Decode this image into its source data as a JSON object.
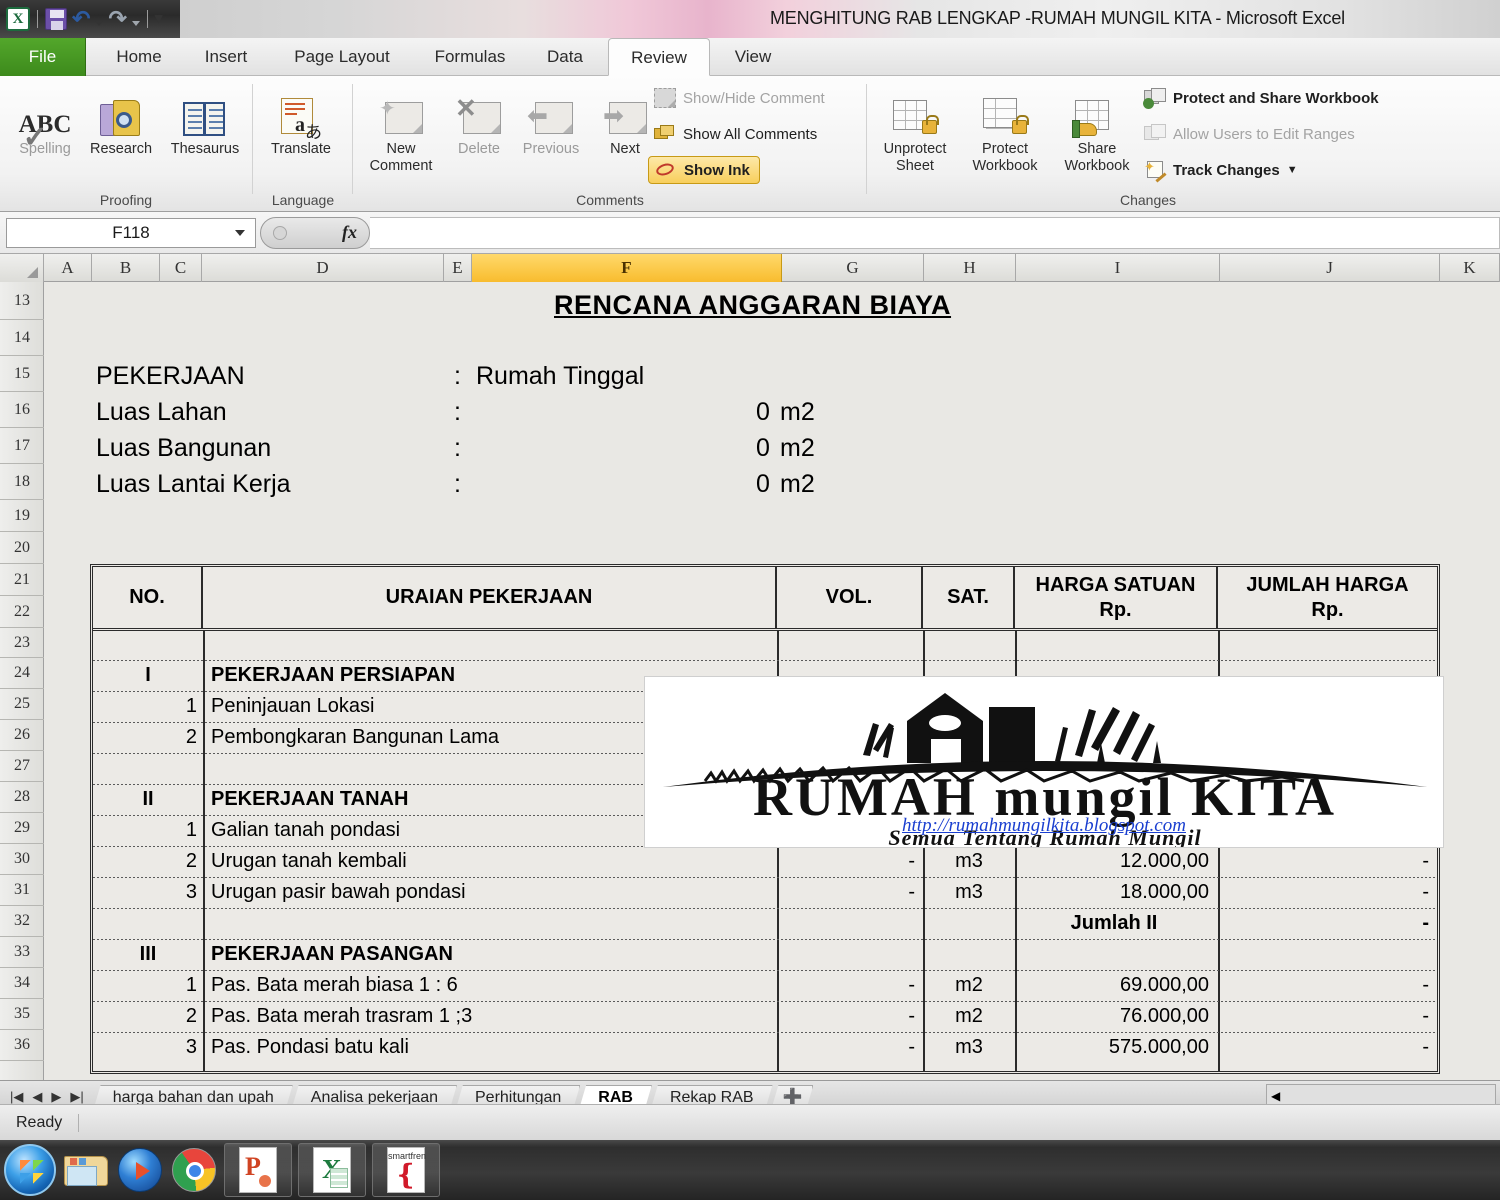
{
  "window": {
    "title": "MENGHITUNG RAB LENGKAP -RUMAH MUNGIL KITA  -  Microsoft Excel"
  },
  "quick_access": {
    "app_icon": "excel-logo-icon",
    "items": [
      {
        "name": "save-icon",
        "label": "Save"
      },
      {
        "name": "undo-icon",
        "label": "Undo"
      },
      {
        "name": "redo-icon",
        "label": "Redo"
      },
      {
        "name": "customize-qat-icon",
        "label": "Customize Quick Access Toolbar"
      }
    ]
  },
  "ribbon": {
    "tabs": [
      {
        "label": "File"
      },
      {
        "label": "Home"
      },
      {
        "label": "Insert"
      },
      {
        "label": "Page Layout"
      },
      {
        "label": "Formulas"
      },
      {
        "label": "Data"
      },
      {
        "label": "Review"
      },
      {
        "label": "View"
      }
    ],
    "active_tab": "Review",
    "groups": {
      "proofing": {
        "label": "Proofing",
        "buttons": [
          {
            "label": "Spelling",
            "icon": "abc-check-icon"
          },
          {
            "label": "Research",
            "icon": "book-magnifier-icon"
          },
          {
            "label": "Thesaurus",
            "icon": "open-book-icon"
          }
        ]
      },
      "language": {
        "label": "Language",
        "buttons": [
          {
            "label": "Translate",
            "icon": "translate-icon"
          }
        ]
      },
      "comments": {
        "label": "Comments",
        "buttons": [
          {
            "label_line1": "New",
            "label_line2": "Comment",
            "icon": "new-comment-icon"
          },
          {
            "label_line1": "Delete",
            "label_line2": "",
            "icon": "delete-comment-icon"
          },
          {
            "label_line1": "Previous",
            "label_line2": "",
            "icon": "previous-comment-icon"
          },
          {
            "label_line1": "Next",
            "label_line2": "",
            "icon": "next-comment-icon"
          }
        ],
        "small_items": [
          {
            "label": "Show/Hide Comment",
            "icon": "show-hide-comment-icon",
            "disabled": true
          },
          {
            "label": "Show All Comments",
            "icon": "show-all-comments-icon",
            "disabled": false
          },
          {
            "label": "Show Ink",
            "icon": "show-ink-icon",
            "disabled": false,
            "active": true
          }
        ]
      },
      "changes": {
        "label": "Changes",
        "buttons": [
          {
            "label_line1": "Unprotect",
            "label_line2": "Sheet",
            "icon": "unprotect-sheet-icon"
          },
          {
            "label_line1": "Protect",
            "label_line2": "Workbook",
            "icon": "protect-workbook-icon"
          },
          {
            "label_line1": "Share",
            "label_line2": "Workbook",
            "icon": "share-workbook-icon"
          }
        ],
        "small_items": [
          {
            "label": "Protect and Share Workbook",
            "icon": "protect-share-workbook-icon",
            "disabled": false
          },
          {
            "label": "Allow Users to Edit Ranges",
            "icon": "allow-users-edit-ranges-icon",
            "disabled": true
          },
          {
            "label": "Track Changes",
            "icon": "track-changes-icon",
            "disabled": false,
            "dropdown": true
          }
        ]
      }
    }
  },
  "formula_bar": {
    "name_box_value": "F118",
    "formula_value": "",
    "fx_label": "fx"
  },
  "grid": {
    "columns": [
      "A",
      "B",
      "C",
      "D",
      "E",
      "F",
      "G",
      "H",
      "I",
      "J",
      "K"
    ],
    "selected_column": "F",
    "rows": [
      "13",
      "14",
      "15",
      "16",
      "17",
      "18",
      "19",
      "20",
      "21",
      "22",
      "23",
      "24",
      "25",
      "26",
      "27",
      "28",
      "29",
      "30",
      "31",
      "32",
      "33",
      "34",
      "35",
      "36"
    ]
  },
  "sheet_content": {
    "title": "RENCANA ANGGARAN BIAYA",
    "info_rows": [
      {
        "label": "PEKERJAAN",
        "sep": ":",
        "value": "Rumah Tinggal",
        "unit": ""
      },
      {
        "label": "Luas Lahan",
        "sep": ":",
        "value": "0",
        "unit": "m2"
      },
      {
        "label": "Luas Bangunan",
        "sep": ":",
        "value": "0",
        "unit": "m2"
      },
      {
        "label": "Luas Lantai Kerja",
        "sep": ":",
        "value": "0",
        "unit": "m2"
      }
    ],
    "table_headers": [
      {
        "line1": "NO.",
        "line2": ""
      },
      {
        "line1": "URAIAN PEKERJAAN",
        "line2": ""
      },
      {
        "line1": "VOL.",
        "line2": ""
      },
      {
        "line1": "SAT.",
        "line2": ""
      },
      {
        "line1": "HARGA SATUAN",
        "line2": "Rp."
      },
      {
        "line1": "JUMLAH HARGA",
        "line2": "Rp."
      }
    ],
    "table_rows": [
      {
        "row": "23",
        "no": "",
        "uraian": "",
        "vol": "",
        "sat": "",
        "harga": "",
        "jumlah": "",
        "type": "blank"
      },
      {
        "row": "24",
        "no": "I",
        "uraian": "PEKERJAAN PERSIAPAN",
        "vol": "",
        "sat": "",
        "harga": "",
        "jumlah": "",
        "type": "section"
      },
      {
        "row": "25",
        "no": "1",
        "uraian": "Peninjauan Lokasi",
        "vol": "",
        "sat": "",
        "harga": "",
        "jumlah": "",
        "type": "item"
      },
      {
        "row": "26",
        "no": "2",
        "uraian": "Pembongkaran Bangunan Lama",
        "vol": "",
        "sat": "",
        "harga": "",
        "jumlah": "",
        "type": "item"
      },
      {
        "row": "27",
        "no": "",
        "uraian": "",
        "vol": "",
        "sat": "",
        "harga": "",
        "jumlah": "",
        "type": "blank"
      },
      {
        "row": "28",
        "no": "II",
        "uraian": "PEKERJAAN TANAH",
        "vol": "",
        "sat": "",
        "harga": "",
        "jumlah": "",
        "type": "section"
      },
      {
        "row": "29",
        "no": "1",
        "uraian": "Galian tanah pondasi",
        "vol": "",
        "sat": "",
        "harga": "",
        "jumlah": "",
        "type": "item"
      },
      {
        "row": "30",
        "no": "2",
        "uraian": "Urugan tanah kembali",
        "vol": "-",
        "sat": "m3",
        "harga": "12.000,00",
        "jumlah": "-",
        "type": "item"
      },
      {
        "row": "31",
        "no": "3",
        "uraian": "Urugan pasir bawah pondasi",
        "vol": "-",
        "sat": "m3",
        "harga": "18.000,00",
        "jumlah": "-",
        "type": "item"
      },
      {
        "row": "32",
        "no": "",
        "uraian": "",
        "vol": "",
        "sat": "",
        "harga": "Jumlah II",
        "jumlah": "-",
        "type": "total"
      },
      {
        "row": "33",
        "no": "III",
        "uraian": "PEKERJAAN PASANGAN",
        "vol": "",
        "sat": "",
        "harga": "",
        "jumlah": "",
        "type": "section"
      },
      {
        "row": "34",
        "no": "1",
        "uraian": "Pas. Bata merah biasa 1 : 6",
        "vol": "-",
        "sat": "m2",
        "harga": "69.000,00",
        "jumlah": "-",
        "type": "item"
      },
      {
        "row": "35",
        "no": "2",
        "uraian": "Pas. Bata merah trasram 1 ;3",
        "vol": "-",
        "sat": "m2",
        "harga": "76.000,00",
        "jumlah": "-",
        "type": "item"
      },
      {
        "row": "36",
        "no": "3",
        "uraian": "Pas. Pondasi batu kali",
        "vol": "-",
        "sat": "m3",
        "harga": "575.000,00",
        "jumlah": "-",
        "type": "item"
      }
    ]
  },
  "logo_overlay": {
    "brand_line1": "RUMAH mungil KITA",
    "tagline": "Semua Tentang Rumah Mungil",
    "url": "http://rumahmungilkita.blogspot.com"
  },
  "sheet_tabs": {
    "nav": [
      "|◀",
      "◀",
      "▶",
      "▶|"
    ],
    "tabs": [
      {
        "label": "harga bahan dan upah",
        "active": false
      },
      {
        "label": "Analisa pekerjaan",
        "active": false
      },
      {
        "label": "Perhitungan",
        "active": false
      },
      {
        "label": "RAB",
        "active": true
      },
      {
        "label": "Rekap RAB",
        "active": false
      }
    ],
    "new_sheet_label": "➕"
  },
  "status_bar": {
    "state": "Ready"
  },
  "taskbar": {
    "items": [
      {
        "name": "start-button",
        "label": "Start"
      },
      {
        "name": "windows-explorer-icon",
        "label": "Windows Explorer"
      },
      {
        "name": "media-player-icon",
        "label": "Windows Media Player"
      },
      {
        "name": "chrome-icon",
        "label": "Google Chrome"
      },
      {
        "name": "powerpoint-icon",
        "label": "Microsoft PowerPoint"
      },
      {
        "name": "excel-icon",
        "label": "Microsoft Excel"
      },
      {
        "name": "smartfren-icon",
        "label": "Smartfren"
      }
    ],
    "smartfren_label": "smartfren"
  },
  "colors": {
    "accent_green": "#53a72b",
    "selection_orange": "#f8bc2e",
    "show_ink_active": "#f8cf5c",
    "link_blue": "#1a3fd0"
  }
}
